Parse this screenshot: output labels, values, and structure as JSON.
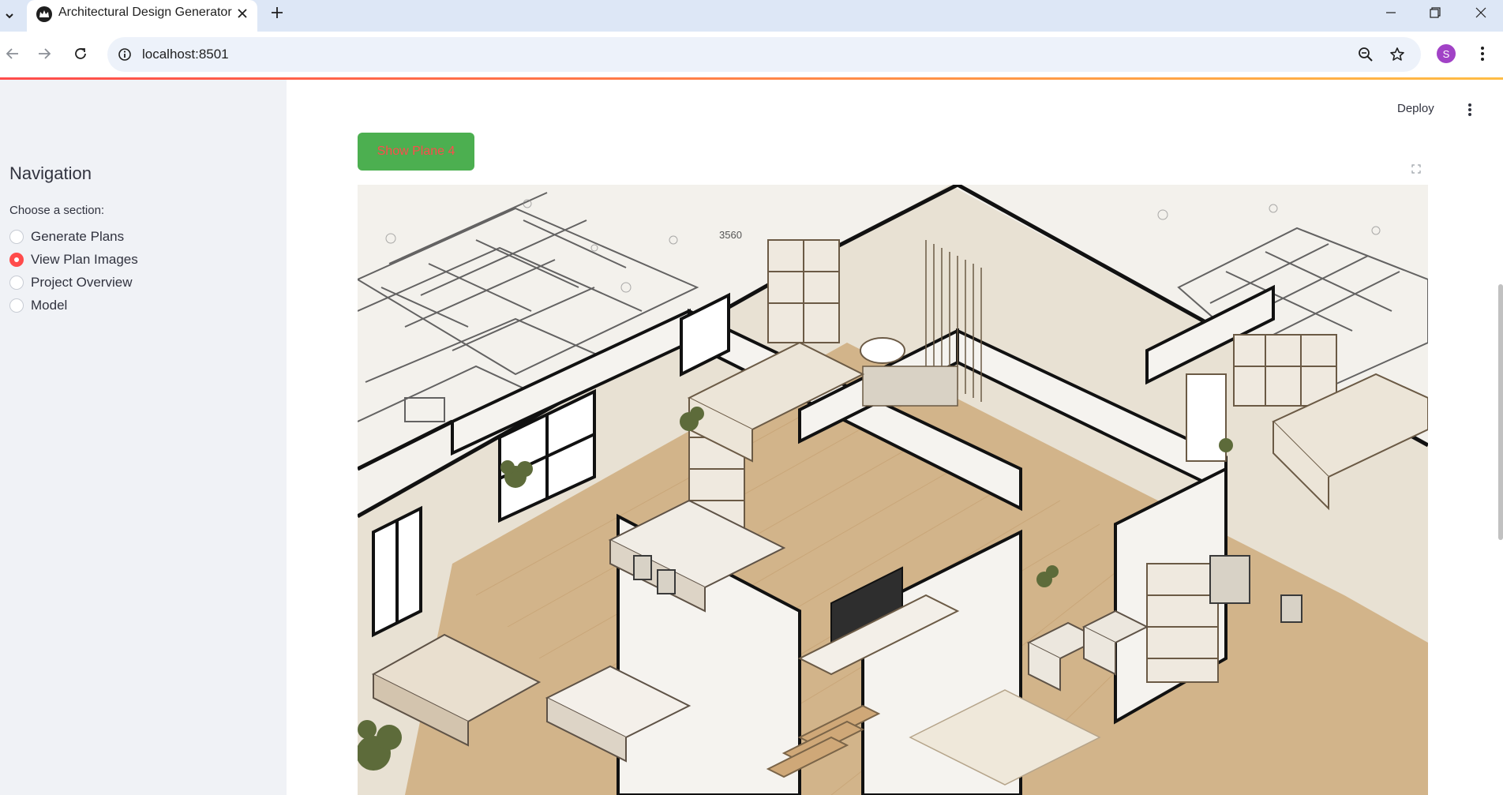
{
  "browser": {
    "tab_title": "Architectural Design Generator",
    "url": "localhost:8501",
    "profile_initial": "S",
    "icons": {
      "tab_search": "chevron-down-icon",
      "favicon": "streamlit-crown-icon",
      "close_tab": "close-icon",
      "new_tab": "plus-icon",
      "back": "arrow-left-icon",
      "forward": "arrow-right-icon",
      "reload": "reload-icon",
      "site_info": "info-icon",
      "zoom": "zoom-icon",
      "bookmark": "star-icon",
      "menu": "kebab-icon"
    }
  },
  "sidebar": {
    "title": "Navigation",
    "radio_label": "Choose a section:",
    "options": [
      {
        "label": "Generate Plans",
        "selected": false
      },
      {
        "label": "View Plan Images",
        "selected": true
      },
      {
        "label": "Project Overview",
        "selected": false
      },
      {
        "label": "Model",
        "selected": false
      }
    ]
  },
  "header": {
    "deploy_label": "Deploy"
  },
  "main": {
    "button_label": "Show Plane 4",
    "image": {
      "description_icon": "isometric-floor-plan-image",
      "sketch_text": "3560"
    }
  },
  "colors": {
    "accent": "#ff4b4b",
    "button_bg": "#4caf50",
    "sidebar_bg": "#f0f2f6",
    "profile": "#a142c6"
  }
}
